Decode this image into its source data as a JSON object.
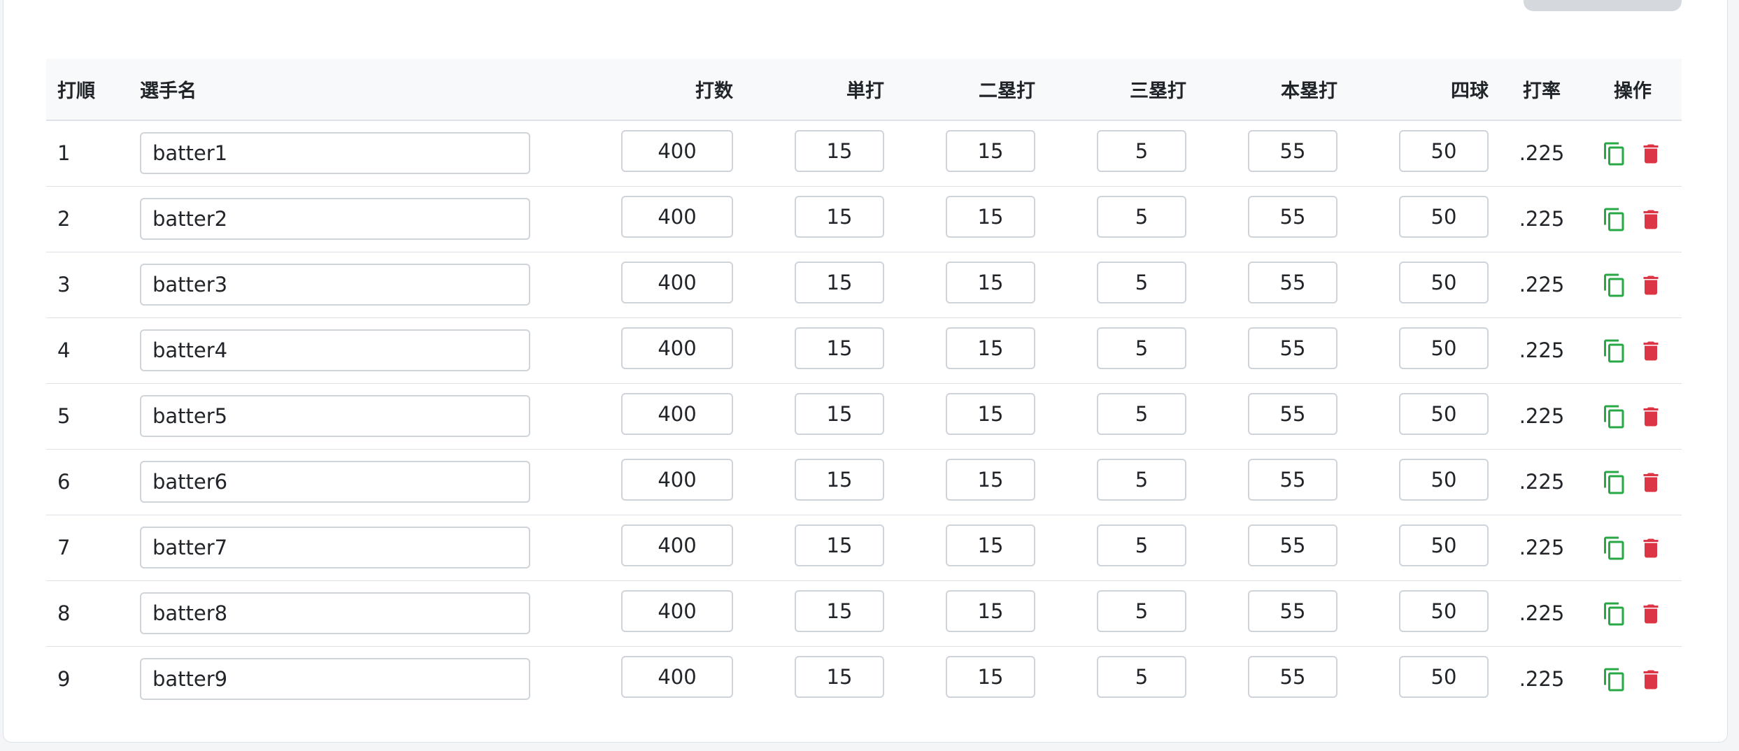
{
  "colors": {
    "copy": "#28a745",
    "delete": "#dc3545"
  },
  "table": {
    "headers": {
      "order": "打順",
      "name": "選手名",
      "at_bats": "打数",
      "singles": "単打",
      "doubles": "二塁打",
      "triples": "三塁打",
      "home_runs": "本塁打",
      "walks": "四球",
      "average": "打率",
      "actions": "操作"
    },
    "rows": [
      {
        "order": "1",
        "name": "batter1",
        "at_bats": "400",
        "singles": "15",
        "doubles": "15",
        "triples": "5",
        "home_runs": "55",
        "walks": "50",
        "average": ".225"
      },
      {
        "order": "2",
        "name": "batter2",
        "at_bats": "400",
        "singles": "15",
        "doubles": "15",
        "triples": "5",
        "home_runs": "55",
        "walks": "50",
        "average": ".225"
      },
      {
        "order": "3",
        "name": "batter3",
        "at_bats": "400",
        "singles": "15",
        "doubles": "15",
        "triples": "5",
        "home_runs": "55",
        "walks": "50",
        "average": ".225"
      },
      {
        "order": "4",
        "name": "batter4",
        "at_bats": "400",
        "singles": "15",
        "doubles": "15",
        "triples": "5",
        "home_runs": "55",
        "walks": "50",
        "average": ".225"
      },
      {
        "order": "5",
        "name": "batter5",
        "at_bats": "400",
        "singles": "15",
        "doubles": "15",
        "triples": "5",
        "home_runs": "55",
        "walks": "50",
        "average": ".225"
      },
      {
        "order": "6",
        "name": "batter6",
        "at_bats": "400",
        "singles": "15",
        "doubles": "15",
        "triples": "5",
        "home_runs": "55",
        "walks": "50",
        "average": ".225"
      },
      {
        "order": "7",
        "name": "batter7",
        "at_bats": "400",
        "singles": "15",
        "doubles": "15",
        "triples": "5",
        "home_runs": "55",
        "walks": "50",
        "average": ".225"
      },
      {
        "order": "8",
        "name": "batter8",
        "at_bats": "400",
        "singles": "15",
        "doubles": "15",
        "triples": "5",
        "home_runs": "55",
        "walks": "50",
        "average": ".225"
      },
      {
        "order": "9",
        "name": "batter9",
        "at_bats": "400",
        "singles": "15",
        "doubles": "15",
        "triples": "5",
        "home_runs": "55",
        "walks": "50",
        "average": ".225"
      }
    ],
    "row_icons": {
      "copy": "copy-icon",
      "delete": "trash-icon"
    }
  }
}
